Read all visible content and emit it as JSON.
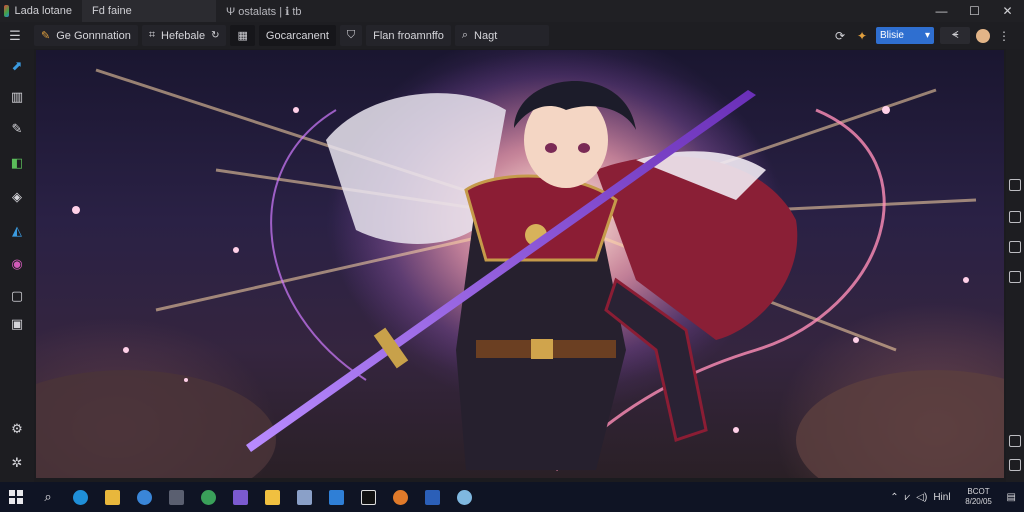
{
  "titlebar": {
    "app_title": "Lada lotane",
    "tabs": [
      {
        "label": "Fd faine"
      },
      {
        "label": "Ψ ostalats  |  ℹ tb"
      }
    ],
    "controls": {
      "minimize": "—",
      "maximize": "☐",
      "close": "✕"
    }
  },
  "toolbar": {
    "items": [
      {
        "label": "Ge Gonnnation",
        "icon": "brush-icon"
      },
      {
        "label": "Hefebale",
        "icon": "tag-icon"
      },
      {
        "label": "Gocarcanent",
        "icon": "grid-icon"
      },
      {
        "label": "Flan froamnffo",
        "icon": "shield-icon"
      },
      {
        "label": "Nagt",
        "icon": "search-icon"
      }
    ],
    "zoom_label": "Blisie",
    "select_label": "ᗛ"
  },
  "leftbar": {
    "icons": [
      "cursor-icon",
      "book-icon",
      "brush-icon",
      "layers-icon",
      "cube-icon",
      "paint-icon",
      "palette-icon",
      "frame-icon",
      "chat-icon",
      "settings-icon",
      "plugin-icon"
    ]
  },
  "taskbar": {
    "apps": [
      "windows-start-icon",
      "search-icon",
      "edge-icon",
      "folder-icon",
      "ie-icon",
      "film-icon",
      "chrome-icon",
      "photo-icon",
      "files-icon",
      "notepad-icon",
      "store-icon",
      "tiktok-icon",
      "firefox-icon",
      "word-icon",
      "weather-icon"
    ],
    "tray_text": "Hinl",
    "clock_time": "BCOT",
    "clock_date": "8/20/05"
  },
  "colors": {
    "accent": "#2f6fd0",
    "taskbar": "#0f1424",
    "chrome": "#1e1e22"
  }
}
